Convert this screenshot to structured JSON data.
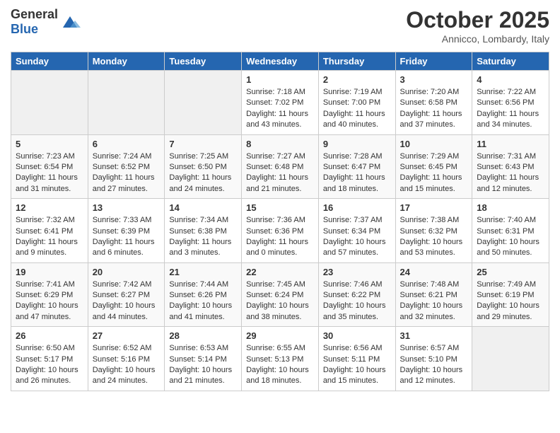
{
  "header": {
    "logo_general": "General",
    "logo_blue": "Blue",
    "month_title": "October 2025",
    "location": "Annicco, Lombardy, Italy"
  },
  "days_of_week": [
    "Sunday",
    "Monday",
    "Tuesday",
    "Wednesday",
    "Thursday",
    "Friday",
    "Saturday"
  ],
  "weeks": [
    [
      {
        "day": "",
        "info": []
      },
      {
        "day": "",
        "info": []
      },
      {
        "day": "",
        "info": []
      },
      {
        "day": "1",
        "info": [
          "Sunrise: 7:18 AM",
          "Sunset: 7:02 PM",
          "Daylight: 11 hours",
          "and 43 minutes."
        ]
      },
      {
        "day": "2",
        "info": [
          "Sunrise: 7:19 AM",
          "Sunset: 7:00 PM",
          "Daylight: 11 hours",
          "and 40 minutes."
        ]
      },
      {
        "day": "3",
        "info": [
          "Sunrise: 7:20 AM",
          "Sunset: 6:58 PM",
          "Daylight: 11 hours",
          "and 37 minutes."
        ]
      },
      {
        "day": "4",
        "info": [
          "Sunrise: 7:22 AM",
          "Sunset: 6:56 PM",
          "Daylight: 11 hours",
          "and 34 minutes."
        ]
      }
    ],
    [
      {
        "day": "5",
        "info": [
          "Sunrise: 7:23 AM",
          "Sunset: 6:54 PM",
          "Daylight: 11 hours",
          "and 31 minutes."
        ]
      },
      {
        "day": "6",
        "info": [
          "Sunrise: 7:24 AM",
          "Sunset: 6:52 PM",
          "Daylight: 11 hours",
          "and 27 minutes."
        ]
      },
      {
        "day": "7",
        "info": [
          "Sunrise: 7:25 AM",
          "Sunset: 6:50 PM",
          "Daylight: 11 hours",
          "and 24 minutes."
        ]
      },
      {
        "day": "8",
        "info": [
          "Sunrise: 7:27 AM",
          "Sunset: 6:48 PM",
          "Daylight: 11 hours",
          "and 21 minutes."
        ]
      },
      {
        "day": "9",
        "info": [
          "Sunrise: 7:28 AM",
          "Sunset: 6:47 PM",
          "Daylight: 11 hours",
          "and 18 minutes."
        ]
      },
      {
        "day": "10",
        "info": [
          "Sunrise: 7:29 AM",
          "Sunset: 6:45 PM",
          "Daylight: 11 hours",
          "and 15 minutes."
        ]
      },
      {
        "day": "11",
        "info": [
          "Sunrise: 7:31 AM",
          "Sunset: 6:43 PM",
          "Daylight: 11 hours",
          "and 12 minutes."
        ]
      }
    ],
    [
      {
        "day": "12",
        "info": [
          "Sunrise: 7:32 AM",
          "Sunset: 6:41 PM",
          "Daylight: 11 hours",
          "and 9 minutes."
        ]
      },
      {
        "day": "13",
        "info": [
          "Sunrise: 7:33 AM",
          "Sunset: 6:39 PM",
          "Daylight: 11 hours",
          "and 6 minutes."
        ]
      },
      {
        "day": "14",
        "info": [
          "Sunrise: 7:34 AM",
          "Sunset: 6:38 PM",
          "Daylight: 11 hours",
          "and 3 minutes."
        ]
      },
      {
        "day": "15",
        "info": [
          "Sunrise: 7:36 AM",
          "Sunset: 6:36 PM",
          "Daylight: 11 hours",
          "and 0 minutes."
        ]
      },
      {
        "day": "16",
        "info": [
          "Sunrise: 7:37 AM",
          "Sunset: 6:34 PM",
          "Daylight: 10 hours",
          "and 57 minutes."
        ]
      },
      {
        "day": "17",
        "info": [
          "Sunrise: 7:38 AM",
          "Sunset: 6:32 PM",
          "Daylight: 10 hours",
          "and 53 minutes."
        ]
      },
      {
        "day": "18",
        "info": [
          "Sunrise: 7:40 AM",
          "Sunset: 6:31 PM",
          "Daylight: 10 hours",
          "and 50 minutes."
        ]
      }
    ],
    [
      {
        "day": "19",
        "info": [
          "Sunrise: 7:41 AM",
          "Sunset: 6:29 PM",
          "Daylight: 10 hours",
          "and 47 minutes."
        ]
      },
      {
        "day": "20",
        "info": [
          "Sunrise: 7:42 AM",
          "Sunset: 6:27 PM",
          "Daylight: 10 hours",
          "and 44 minutes."
        ]
      },
      {
        "day": "21",
        "info": [
          "Sunrise: 7:44 AM",
          "Sunset: 6:26 PM",
          "Daylight: 10 hours",
          "and 41 minutes."
        ]
      },
      {
        "day": "22",
        "info": [
          "Sunrise: 7:45 AM",
          "Sunset: 6:24 PM",
          "Daylight: 10 hours",
          "and 38 minutes."
        ]
      },
      {
        "day": "23",
        "info": [
          "Sunrise: 7:46 AM",
          "Sunset: 6:22 PM",
          "Daylight: 10 hours",
          "and 35 minutes."
        ]
      },
      {
        "day": "24",
        "info": [
          "Sunrise: 7:48 AM",
          "Sunset: 6:21 PM",
          "Daylight: 10 hours",
          "and 32 minutes."
        ]
      },
      {
        "day": "25",
        "info": [
          "Sunrise: 7:49 AM",
          "Sunset: 6:19 PM",
          "Daylight: 10 hours",
          "and 29 minutes."
        ]
      }
    ],
    [
      {
        "day": "26",
        "info": [
          "Sunrise: 6:50 AM",
          "Sunset: 5:17 PM",
          "Daylight: 10 hours",
          "and 26 minutes."
        ]
      },
      {
        "day": "27",
        "info": [
          "Sunrise: 6:52 AM",
          "Sunset: 5:16 PM",
          "Daylight: 10 hours",
          "and 24 minutes."
        ]
      },
      {
        "day": "28",
        "info": [
          "Sunrise: 6:53 AM",
          "Sunset: 5:14 PM",
          "Daylight: 10 hours",
          "and 21 minutes."
        ]
      },
      {
        "day": "29",
        "info": [
          "Sunrise: 6:55 AM",
          "Sunset: 5:13 PM",
          "Daylight: 10 hours",
          "and 18 minutes."
        ]
      },
      {
        "day": "30",
        "info": [
          "Sunrise: 6:56 AM",
          "Sunset: 5:11 PM",
          "Daylight: 10 hours",
          "and 15 minutes."
        ]
      },
      {
        "day": "31",
        "info": [
          "Sunrise: 6:57 AM",
          "Sunset: 5:10 PM",
          "Daylight: 10 hours",
          "and 12 minutes."
        ]
      },
      {
        "day": "",
        "info": []
      }
    ]
  ]
}
